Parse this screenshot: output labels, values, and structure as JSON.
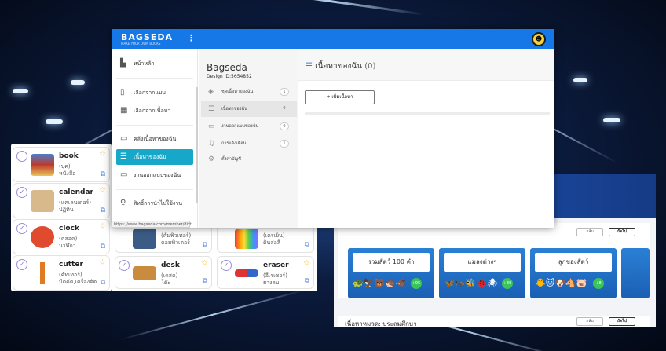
{
  "app": {
    "logo": "BAGSEDA",
    "tagline": "MAKE YOUR OWN BOOKS",
    "kebab": "⋮",
    "avatar_glyph": "☻",
    "accent": "#1677e6",
    "active_color": "#17a7c9"
  },
  "sidebar": {
    "items": [
      {
        "label": "หน้าหลัก",
        "icon": "home-icon"
      },
      {
        "label": "เลือกจากแบบ",
        "icon": "template-icon"
      },
      {
        "label": "เลือกจากเนื้อหา",
        "icon": "content-grid-icon"
      },
      {
        "label": "คลังเนื้อหาของฉัน",
        "icon": "folder-icon"
      },
      {
        "label": "เนื้อหาของฉัน",
        "icon": "list-icon"
      },
      {
        "label": "งานออกแบบของฉัน",
        "icon": "box-icon"
      },
      {
        "label": "สิทธิ์การนำไปใช้งาน",
        "icon": "bulb-icon"
      }
    ],
    "status_url": "https://www.bagseda.com/member/dict"
  },
  "panel": {
    "name": "Bagseda",
    "design_id": "Design ID:5654852",
    "items": [
      {
        "label": "ชุดเนื้อหาของฉัน",
        "count": "1"
      },
      {
        "label": "เนื้อหาของฉัน",
        "count": "0"
      },
      {
        "label": "งานออกแบบของฉัน",
        "count": "0"
      },
      {
        "label": "การแจ้งเตือน",
        "count": "1"
      },
      {
        "label": "ตั้งค่าบัญชี",
        "count": ""
      }
    ]
  },
  "content": {
    "title": "เนื้อหาของฉัน",
    "count": "(0)",
    "add_button": "+ เพิ่มเนื้อหา"
  },
  "cards": [
    {
      "word": "book",
      "phonetic": "(บุค)",
      "thai": "หนังสือ",
      "checked": false
    },
    {
      "word": "calendar",
      "phonetic": "(แคเลนเดอร์)",
      "thai": "ปฏิทิน",
      "checked": true
    },
    {
      "word": "clock",
      "phonetic": "(คลอค)",
      "thai": "นาฬิกา",
      "checked": true
    },
    {
      "word": "cutter",
      "phonetic": "(คัทเทอร์)",
      "thai": "มีดคัต,เครื่องตัด",
      "checked": true
    },
    {
      "word": "",
      "phonetic": "(คัมพิวเทอร์)",
      "thai": "คอมพิวเตอร์",
      "checked": false
    },
    {
      "word": "desk",
      "phonetic": "(เดสค)",
      "thai": "โต๊ะ",
      "checked": true
    },
    {
      "word": "",
      "phonetic": "(เครเย็น)",
      "thai": "ดินสอสี",
      "checked": false
    },
    {
      "word": "eraser",
      "phonetic": "(อีเรเซอร์)",
      "thai": "ยางลบ",
      "checked": true
    }
  ],
  "right": {
    "header": "",
    "btn_back": "กลับ",
    "btn_next": "ถัดไป",
    "decks": [
      {
        "label": "รวมสัตว์ 100 คำ",
        "more": "+95",
        "animals": "🐢🦅🐻🦔🐗"
      },
      {
        "label": "แมลงต่างๆ",
        "more": "+30",
        "animals": "🦋🐜🐝🐞🕷"
      },
      {
        "label": "ลูกของสัตว์",
        "more": "+8",
        "animals": "🐥🐱🐶🐴🐷"
      }
    ],
    "category_title": "เนื้อหาหมวด: ประถมศึกษา"
  }
}
